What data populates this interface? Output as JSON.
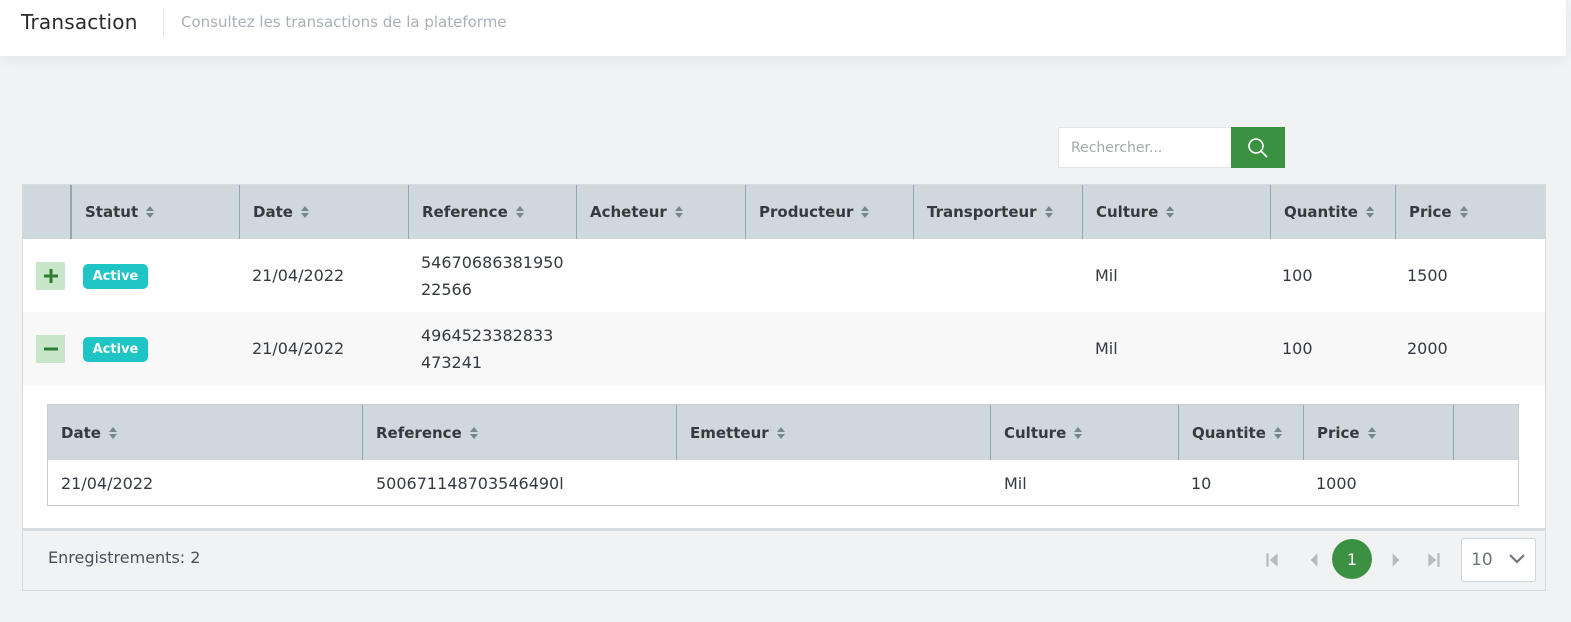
{
  "header": {
    "title": "Transaction",
    "subtitle": "Consultez les transactions de la plateforme"
  },
  "search": {
    "placeholder": "Rechercher..."
  },
  "table": {
    "columns": [
      "Statut",
      "Date",
      "Reference",
      "Acheteur",
      "Producteur",
      "Transporteur",
      "Culture",
      "Quantite",
      "Price"
    ],
    "rows": [
      {
        "expanded": false,
        "status": "Active",
        "date": "21/04/2022",
        "reference_line1": "54670686381950",
        "reference_line2": "22566",
        "acheteur": "",
        "producteur": "",
        "transporteur": "",
        "culture": "Mil",
        "quantite": "100",
        "price": "1500"
      },
      {
        "expanded": true,
        "status": "Active",
        "date": "21/04/2022",
        "reference_line1": "4964523382833",
        "reference_line2": "473241",
        "acheteur": "",
        "producteur": "",
        "transporteur": "",
        "culture": "Mil",
        "quantite": "100",
        "price": "2000"
      }
    ]
  },
  "subtable": {
    "columns": [
      "Date",
      "Reference",
      "Emetteur",
      "Culture",
      "Quantite",
      "Price"
    ],
    "rows": [
      {
        "date": "21/04/2022",
        "reference": "500671148703546490l",
        "emetteur": "",
        "culture": "Mil",
        "quantite": "10",
        "price": "1000"
      }
    ]
  },
  "footer": {
    "records": "Enregistrements: 2",
    "current_page": "1",
    "rows_per_page": "10"
  },
  "colors": {
    "primary_green": "#3b9141",
    "badge_teal": "#1fc5c5",
    "header_gray": "#cfd8dc"
  }
}
